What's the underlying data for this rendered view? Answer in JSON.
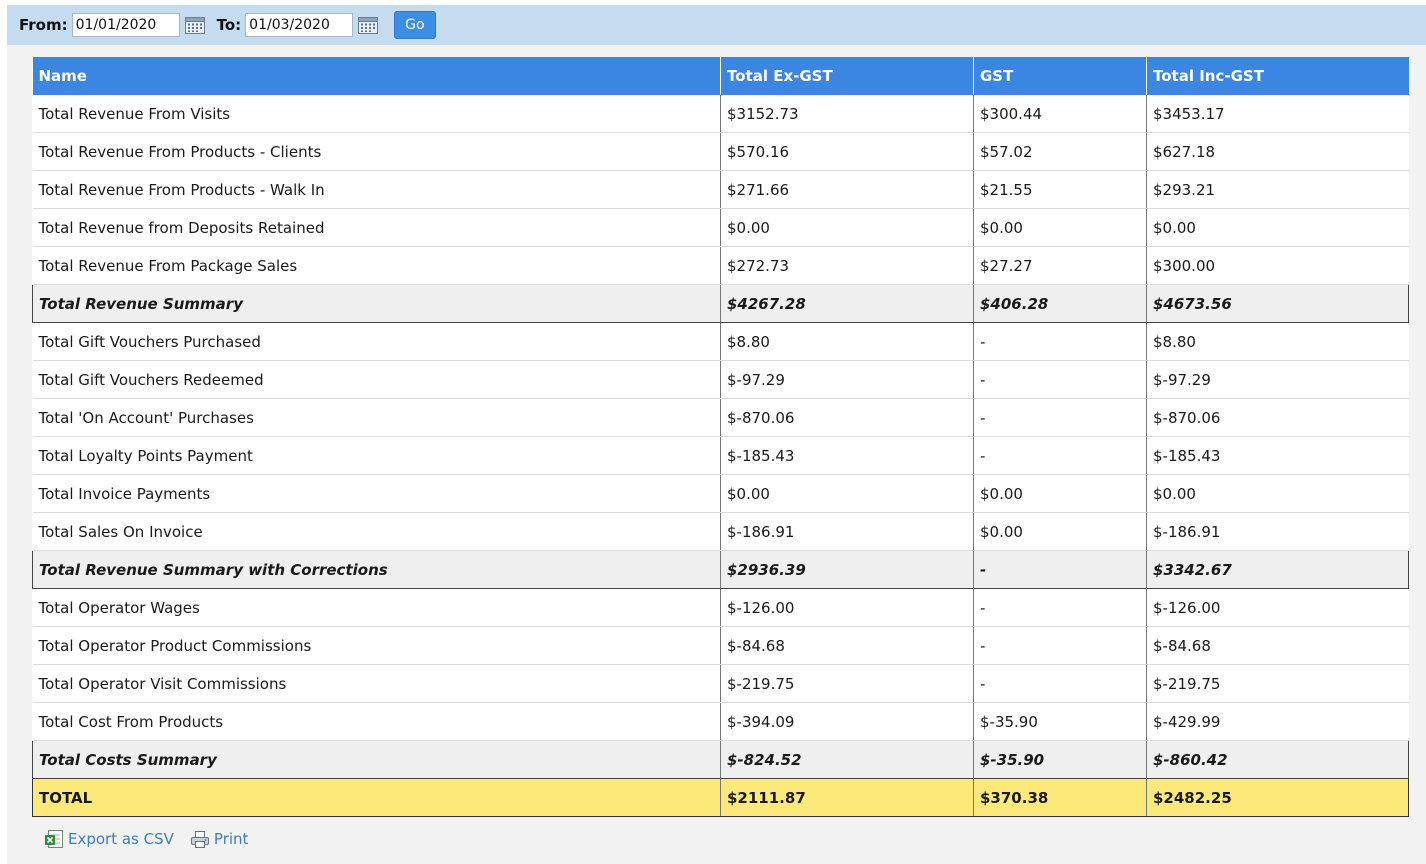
{
  "filters": {
    "from_label": "From:",
    "from_value": "01/01/2020",
    "to_label": "To:",
    "to_value": "01/03/2020",
    "go_label": "Go"
  },
  "table": {
    "headers": [
      "Name",
      "Total Ex-GST",
      "GST",
      "Total Inc-GST"
    ],
    "rows": [
      {
        "type": "normal",
        "cells": [
          "Total Revenue From Visits",
          "$3152.73",
          "$300.44",
          "$3453.17"
        ]
      },
      {
        "type": "normal",
        "cells": [
          "Total Revenue From Products - Clients",
          "$570.16",
          "$57.02",
          "$627.18"
        ]
      },
      {
        "type": "normal",
        "cells": [
          "Total Revenue From Products - Walk In",
          "$271.66",
          "$21.55",
          "$293.21"
        ]
      },
      {
        "type": "normal",
        "cells": [
          "Total Revenue from Deposits Retained",
          "$0.00",
          "$0.00",
          "$0.00"
        ]
      },
      {
        "type": "normal",
        "cells": [
          "Total Revenue From Package Sales",
          "$272.73",
          "$27.27",
          "$300.00"
        ]
      },
      {
        "type": "summary",
        "cells": [
          "Total Revenue Summary",
          "$4267.28",
          "$406.28",
          "$4673.56"
        ]
      },
      {
        "type": "normal",
        "cells": [
          "Total Gift Vouchers Purchased",
          "$8.80",
          "-",
          "$8.80"
        ]
      },
      {
        "type": "normal",
        "cells": [
          "Total Gift Vouchers Redeemed",
          "$-97.29",
          "-",
          "$-97.29"
        ]
      },
      {
        "type": "normal",
        "cells": [
          "Total 'On Account' Purchases",
          "$-870.06",
          "-",
          "$-870.06"
        ]
      },
      {
        "type": "normal",
        "cells": [
          "Total Loyalty Points Payment",
          "$-185.43",
          "-",
          "$-185.43"
        ]
      },
      {
        "type": "normal",
        "cells": [
          "Total Invoice Payments",
          "$0.00",
          "$0.00",
          "$0.00"
        ]
      },
      {
        "type": "normal",
        "cells": [
          "Total Sales On Invoice",
          "$-186.91",
          "$0.00",
          "$-186.91"
        ]
      },
      {
        "type": "summary",
        "cells": [
          "Total Revenue Summary with Corrections",
          "$2936.39",
          "-",
          "$3342.67"
        ]
      },
      {
        "type": "normal",
        "cells": [
          "Total Operator Wages",
          "$-126.00",
          "-",
          "$-126.00"
        ]
      },
      {
        "type": "normal",
        "cells": [
          "Total Operator Product Commissions",
          "$-84.68",
          "-",
          "$-84.68"
        ]
      },
      {
        "type": "normal",
        "cells": [
          "Total Operator Visit Commissions",
          "$-219.75",
          "-",
          "$-219.75"
        ]
      },
      {
        "type": "normal",
        "cells": [
          "Total Cost From Products",
          "$-394.09",
          "$-35.90",
          "$-429.99"
        ]
      },
      {
        "type": "summary",
        "cells": [
          "Total Costs Summary",
          "$-824.52",
          "$-35.90",
          "$-860.42"
        ]
      },
      {
        "type": "total",
        "cells": [
          "TOTAL",
          "$2111.87",
          "$370.38",
          "$2482.25"
        ]
      }
    ]
  },
  "footer": {
    "export_label": "Export as CSV",
    "print_label": "Print"
  },
  "icons": {
    "calendar": "calendar-icon",
    "export": "excel-icon",
    "print": "printer-icon"
  },
  "colors": {
    "filter_bar": "#c5dcf0",
    "header": "#3b86e3",
    "summary_row": "#efefef",
    "total_row": "#fde97a",
    "link": "#3a7dc9",
    "go_button": "#3b8ee6"
  }
}
